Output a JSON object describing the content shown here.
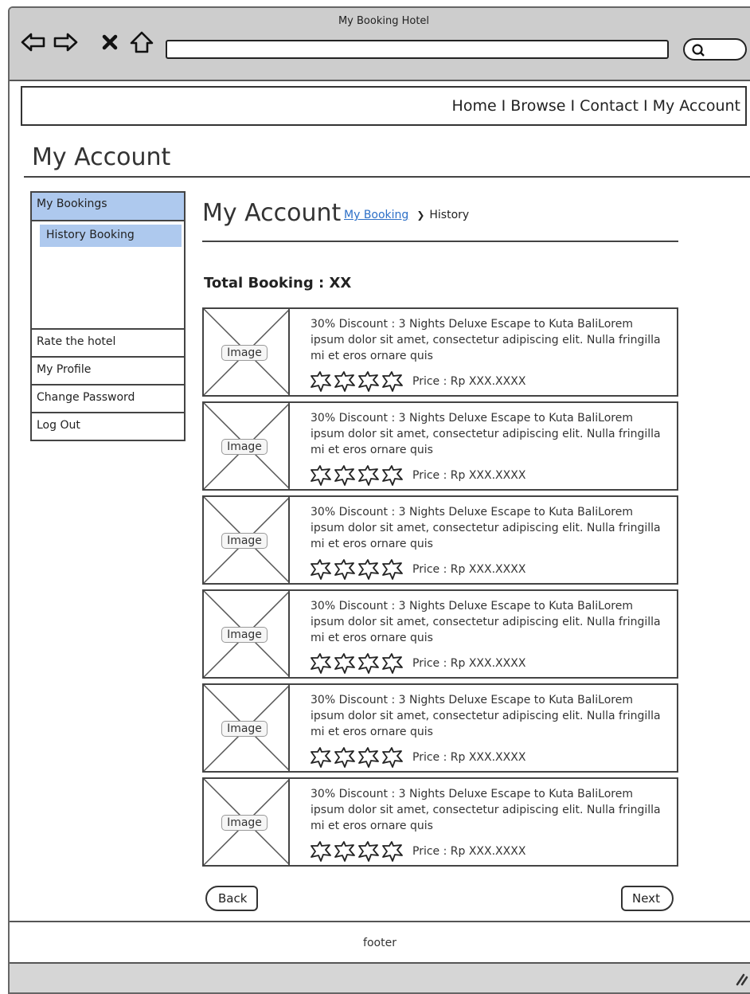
{
  "window": {
    "title": "My Booking Hotel"
  },
  "browser": {
    "back_icon": "arrow-left-icon",
    "forward_icon": "arrow-right-icon",
    "stop_icon": "close-icon",
    "home_icon": "home-icon",
    "search_icon": "search-icon"
  },
  "nav": {
    "items": [
      "Home",
      "Browse",
      "Contact",
      "My Account"
    ],
    "separator": "I"
  },
  "page": {
    "title": "My Account"
  },
  "sidebar": {
    "my_bookings": "My Bookings",
    "history_booking": "History Booking",
    "items": [
      "Rate the hotel",
      "My Profile",
      "Change Password",
      "Log Out"
    ],
    "active_color": "#aec9ee"
  },
  "content": {
    "title": "My Account",
    "breadcrumb": {
      "link": "My Booking",
      "current": "History"
    },
    "total_booking": "Total Booking : XX"
  },
  "bookings": [
    {
      "image_label": "Image",
      "description": "30% Discount : 3 Nights Deluxe Escape to Kuta BaliLorem ipsum dolor sit amet, consectetur adipiscing elit. Nulla fringilla mi et eros ornare quis",
      "stars": 4,
      "price": "Price : Rp XXX.XXXX"
    },
    {
      "image_label": "Image",
      "description": "30% Discount : 3 Nights Deluxe Escape to Kuta BaliLorem ipsum dolor sit amet, consectetur adipiscing elit. Nulla fringilla mi et eros ornare quis",
      "stars": 4,
      "price": "Price : Rp XXX.XXXX"
    },
    {
      "image_label": "Image",
      "description": "30% Discount : 3 Nights Deluxe Escape to Kuta BaliLorem ipsum dolor sit amet, consectetur adipiscing elit. Nulla fringilla mi et eros ornare quis",
      "stars": 4,
      "price": "Price : Rp XXX.XXXX"
    },
    {
      "image_label": "Image",
      "description": "30% Discount : 3 Nights Deluxe Escape to Kuta BaliLorem ipsum dolor sit amet, consectetur adipiscing elit. Nulla fringilla mi et eros ornare quis",
      "stars": 4,
      "price": "Price : Rp XXX.XXXX"
    },
    {
      "image_label": "Image",
      "description": "30% Discount : 3 Nights Deluxe Escape to Kuta BaliLorem ipsum dolor sit amet, consectetur adipiscing elit. Nulla fringilla mi et eros ornare quis",
      "stars": 4,
      "price": "Price : Rp XXX.XXXX"
    },
    {
      "image_label": "Image",
      "description": "30% Discount : 3 Nights Deluxe Escape to Kuta BaliLorem ipsum dolor sit amet, consectetur adipiscing elit. Nulla fringilla mi et eros ornare quis",
      "stars": 4,
      "price": "Price : Rp XXX.XXXX"
    }
  ],
  "pagination": {
    "back": "Back",
    "next": "Next"
  },
  "footer": {
    "text": "footer"
  },
  "colors": {
    "link": "#2c6fc7",
    "chrome": "#cdcdcd",
    "border": "#444444"
  }
}
